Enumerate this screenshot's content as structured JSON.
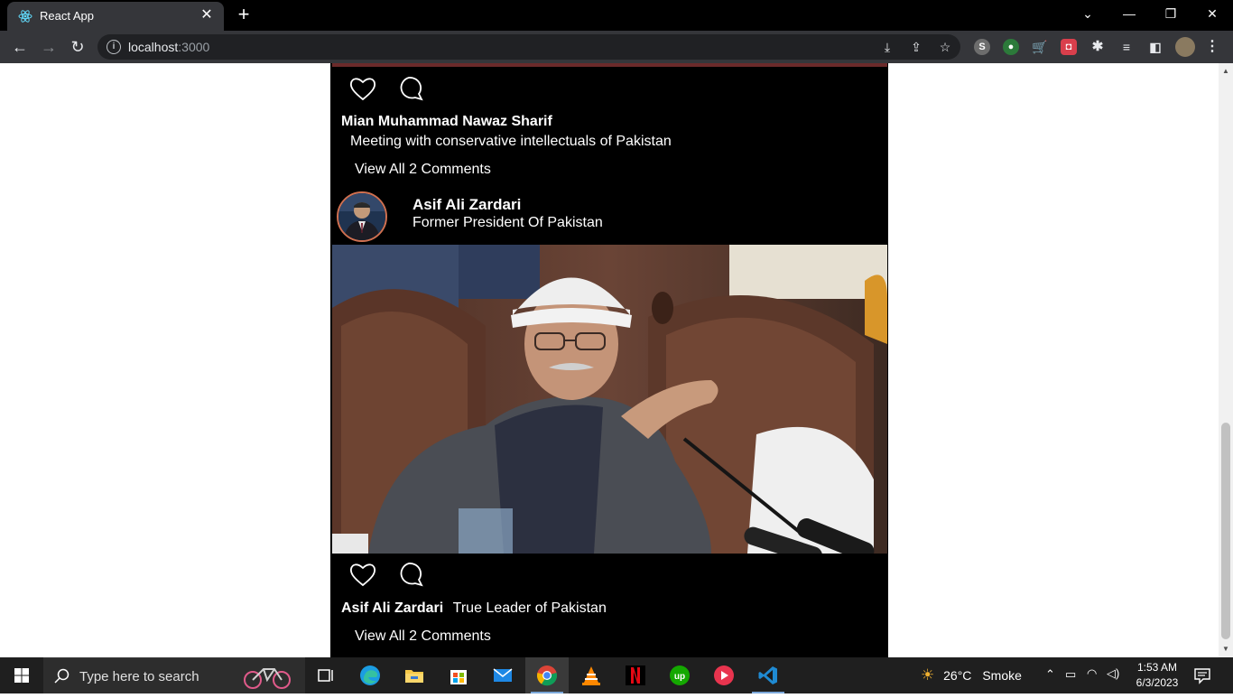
{
  "browser": {
    "tab_title": "React App",
    "url_host": "localhost",
    "url_port": ":3000"
  },
  "posts": [
    {
      "author": "Mian Muhammad Nawaz Sharif",
      "caption": "Meeting with conservative intellectuals of Pakistan",
      "view_comments": "View All 2 Comments"
    },
    {
      "author": "Asif Ali Zardari",
      "subtitle": "Former President Of Pakistan",
      "caption_author": "Asif Ali Zardari",
      "caption": "True Leader of Pakistan",
      "view_comments": "View All 2 Comments"
    }
  ],
  "taskbar": {
    "search_placeholder": "Type here to search",
    "weather_temp": "26°C",
    "weather_desc": "Smoke",
    "time": "1:53 AM",
    "date": "6/3/2023"
  }
}
